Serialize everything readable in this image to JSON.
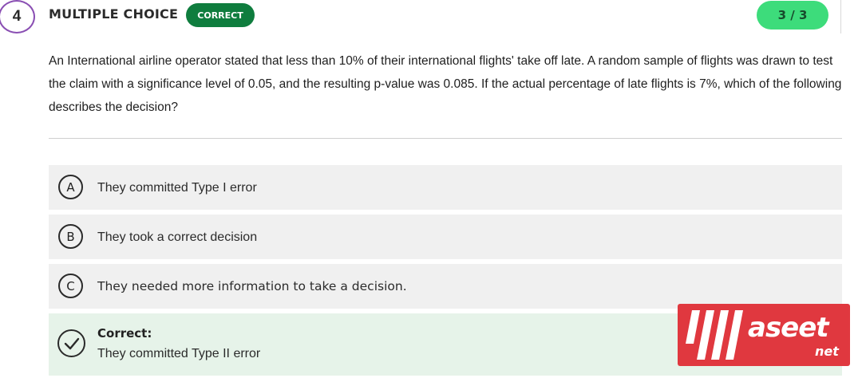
{
  "question": {
    "number": "4",
    "type_label": "MULTIPLE CHOICE",
    "status_badge": "CORRECT",
    "score": "3 / 3",
    "text": "An International airline operator stated that less than 10% of their international flights' take off late. A random sample of flights was drawn to test the claim with a significance level of 0.05, and the resulting p-value was 0.085. If the actual percentage of late flights is 7%, which of the following describes the decision?"
  },
  "options": [
    {
      "letter": "A",
      "text": "They committed Type I error"
    },
    {
      "letter": "B",
      "text": "They took a correct decision"
    },
    {
      "letter": "C",
      "text": "They needed more information to take a decision."
    }
  ],
  "correct_answer": {
    "label": "Correct:",
    "text": "They committed Type II error",
    "icon": "check-circle-icon"
  },
  "watermark": {
    "word": "aseet",
    "sub": "net"
  },
  "colors": {
    "badge": "#0f7d3e",
    "score_pill": "#3ddc7b",
    "option_bg": "#f0f0f0",
    "correct_bg": "#e6f3e9",
    "number_ring": "#8a4fb3",
    "watermark_bg": "#e0383f"
  }
}
